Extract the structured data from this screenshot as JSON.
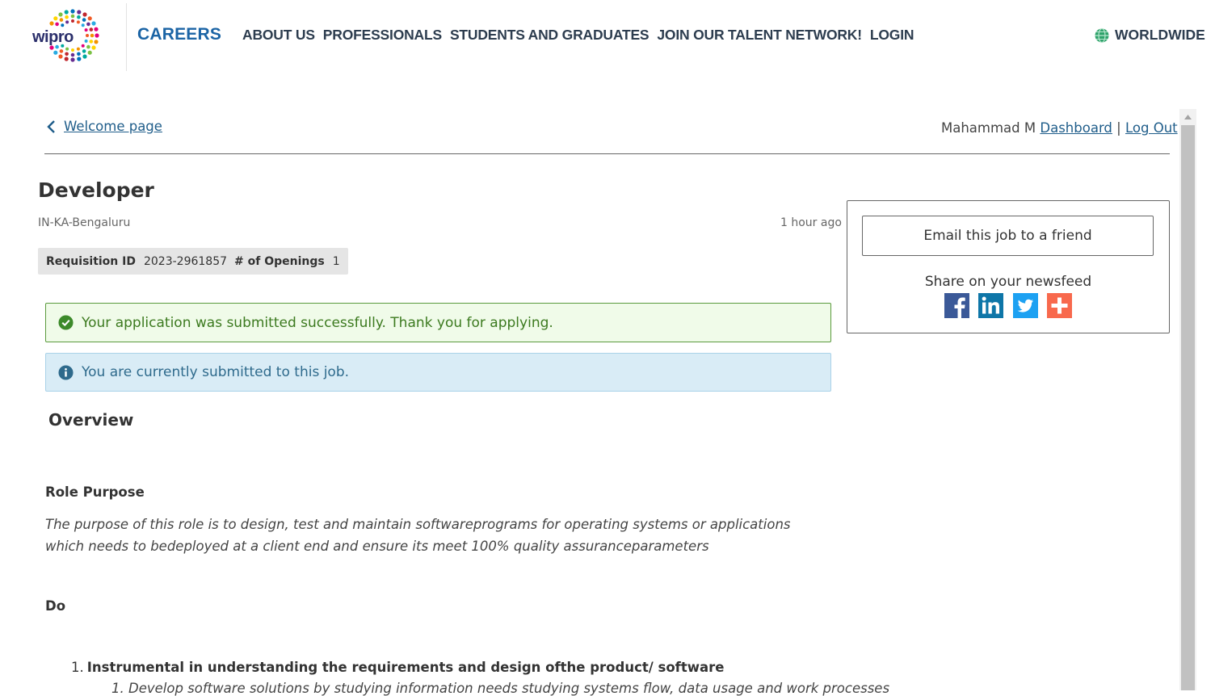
{
  "header": {
    "logo_text": "wipro",
    "careers": "CAREERS",
    "nav": [
      "ABOUT US",
      "PROFESSIONALS",
      "STUDENTS AND GRADUATES",
      "JOIN OUR TALENT NETWORK!",
      "LOGIN"
    ],
    "region": "WORLDWIDE"
  },
  "topbar": {
    "back_label": "Welcome page",
    "user_name": "Mahammad M",
    "dashboard": "Dashboard",
    "separator": "|",
    "logout": "Log Out"
  },
  "job": {
    "title": "Developer",
    "location": "IN-KA-Bengaluru",
    "posted": "1 hour ago",
    "requisition_label": "Requisition ID",
    "requisition_id": "2023-2961857",
    "openings_label": "# of Openings",
    "openings": "1"
  },
  "alerts": {
    "success": "Your application was submitted successfully. Thank you for applying.",
    "info": "You are currently submitted to this job."
  },
  "content": {
    "overview": "Overview",
    "role_purpose_heading": "Role Purpose",
    "role_purpose_text": "The purpose of this role is to design, test and maintain softwareprograms for operating systems or applications which needs to bedeployed at a client end and ensure its meet 100% quality assuranceparameters",
    "do_heading": "Do",
    "list_item_1_num": "1.",
    "list_item_1": "Instrumental in understanding the requirements and design ofthe product/ software",
    "list_item_1_1": "1.  Develop software solutions by studying information needs studying systems flow, data usage and work processes"
  },
  "sidebar": {
    "email_button": "Email this job to a friend",
    "share_label": "Share on your newsfeed",
    "social": [
      "facebook-icon",
      "linkedin-icon",
      "twitter-icon",
      "addthis-icon"
    ]
  },
  "colors": {
    "brand_blue": "#1b64a5",
    "nav_text": "#2d3d4f",
    "link": "#1f5d8a",
    "success_bg": "#f0fbe9",
    "success_border": "#5a9a3d",
    "info_bg": "#d9ecf6",
    "facebook": "#3b5998",
    "linkedin": "#0e76a8",
    "twitter": "#1da1f2",
    "addthis": "#f8694d"
  }
}
